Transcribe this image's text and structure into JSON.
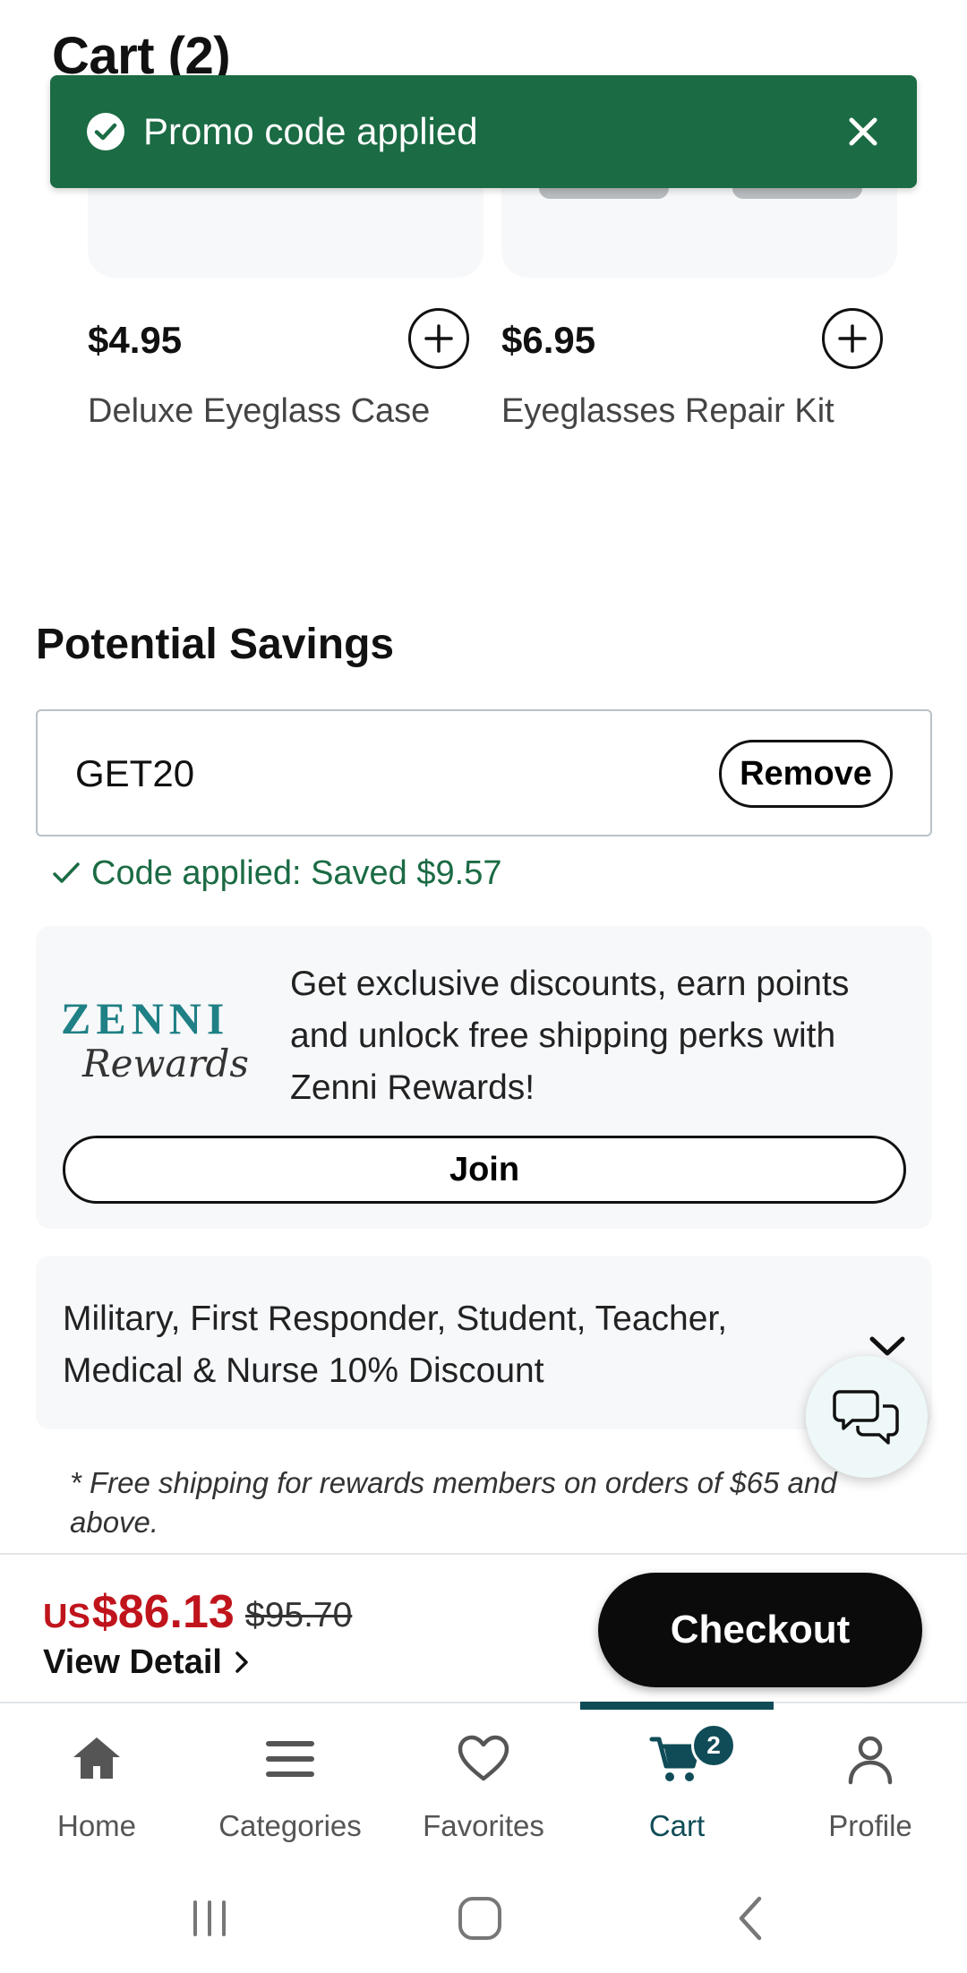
{
  "header": {
    "title": "Cart (2)"
  },
  "toast": {
    "message": "Promo code applied",
    "close_icon": "close-icon",
    "status_icon": "check-circle-icon",
    "color": "#1b6b44"
  },
  "addons": [
    {
      "price": "$4.95",
      "name": "Deluxe Eyeglass Case"
    },
    {
      "price": "$6.95",
      "name": "Eyeglasses Repair Kit"
    }
  ],
  "savings": {
    "title": "Potential Savings",
    "promo_code_value": "GET20",
    "remove_label": "Remove",
    "applied_message": "Code applied: Saved $9.57"
  },
  "rewards": {
    "logo_brand": "ZENNI",
    "logo_script": "Rewards",
    "description": "Get exclusive discounts, earn points and unlock free shipping perks with Zenni Rewards!",
    "join_label": "Join"
  },
  "discount": {
    "label": "Military, First Responder, Student, Teacher, Medical & Nurse 10% Discount"
  },
  "footnote": "* Free shipping for rewards members on orders of $65 and above.",
  "checkout": {
    "currency_prefix": "US",
    "total": "$86.13",
    "original_total": "$95.70",
    "view_detail_label": "View Detail",
    "checkout_label": "Checkout",
    "price_color": "#c0141c"
  },
  "tabs": [
    {
      "label": "Home",
      "icon": "home-icon"
    },
    {
      "label": "Categories",
      "icon": "menu-icon"
    },
    {
      "label": "Favorites",
      "icon": "heart-icon"
    },
    {
      "label": "Cart",
      "icon": "cart-icon",
      "badge": "2",
      "active": true
    },
    {
      "label": "Profile",
      "icon": "user-icon"
    }
  ],
  "accent_color": "#0f4c57"
}
